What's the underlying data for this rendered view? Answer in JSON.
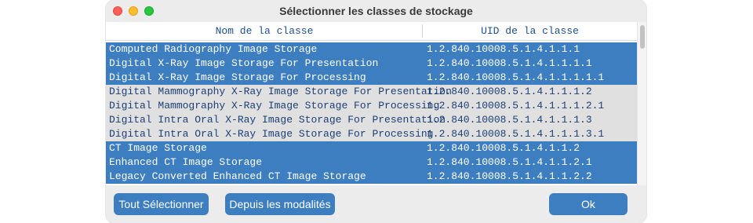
{
  "window": {
    "title": "Sélectionner les classes de stockage"
  },
  "table": {
    "columns": {
      "name": "Nom de la classe",
      "uid": "UID de la classe"
    },
    "rows": [
      {
        "name": "Computed Radiography Image Storage",
        "uid": "1.2.840.10008.5.1.4.1.1.1",
        "selected": true
      },
      {
        "name": "Digital X-Ray Image Storage For Presentation",
        "uid": "1.2.840.10008.5.1.4.1.1.1.1",
        "selected": true
      },
      {
        "name": "Digital X-Ray Image Storage For Processing",
        "uid": "1.2.840.10008.5.1.4.1.1.1.1.1",
        "selected": true
      },
      {
        "name": "Digital Mammography X-Ray Image Storage For Presentation",
        "uid": "1.2.840.10008.5.1.4.1.1.1.2",
        "selected": false
      },
      {
        "name": "Digital Mammography X-Ray Image Storage For Processing",
        "uid": "1.2.840.10008.5.1.4.1.1.1.2.1",
        "selected": false
      },
      {
        "name": "Digital Intra Oral X-Ray Image Storage For Presentation",
        "uid": "1.2.840.10008.5.1.4.1.1.1.3",
        "selected": false
      },
      {
        "name": "Digital Intra Oral X-Ray Image Storage For Processing",
        "uid": "1.2.840.10008.5.1.4.1.1.1.3.1",
        "selected": false
      },
      {
        "name": "CT Image Storage",
        "uid": "1.2.840.10008.5.1.4.1.1.2",
        "selected": true
      },
      {
        "name": "Enhanced CT Image Storage",
        "uid": "1.2.840.10008.5.1.4.1.1.2.1",
        "selected": true
      },
      {
        "name": "Legacy Converted Enhanced CT Image Storage",
        "uid": "1.2.840.10008.5.1.4.1.1.2.2",
        "selected": true
      }
    ]
  },
  "buttons": {
    "select_all": "Tout Sélectionner",
    "from_modalities": "Depuis les modalités",
    "ok": "Ok"
  },
  "colors": {
    "selection": "#3d7ec1",
    "unselected_row": "#e0e0e0",
    "button": "#3d7ec1"
  }
}
